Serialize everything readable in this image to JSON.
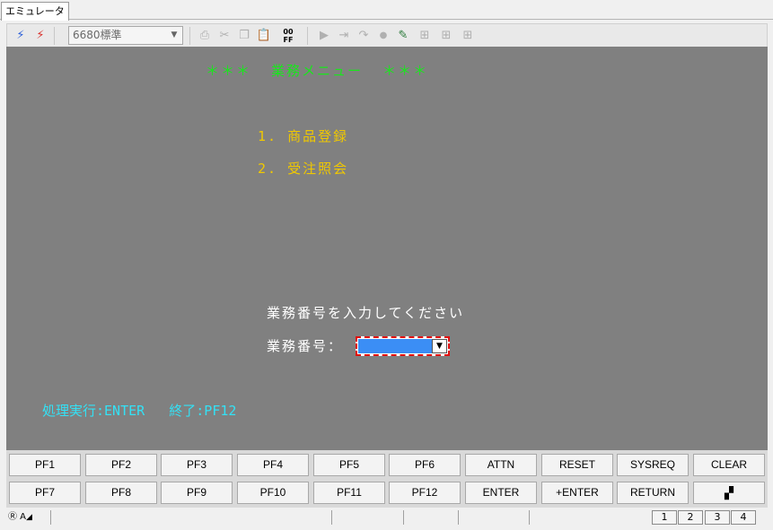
{
  "tab": {
    "label": "エミュレータ"
  },
  "toolbar": {
    "emulation_select": "6680標準",
    "icons": [
      "connect-icon",
      "disconnect-icon",
      "print-icon",
      "cut-icon",
      "copy-icon",
      "paste-icon",
      "onoff-icon",
      "play-icon",
      "step-icon",
      "redo-icon",
      "record-icon",
      "edit-icon",
      "layout1-icon",
      "layout2-icon",
      "layout3-icon"
    ]
  },
  "screen": {
    "title": "＊＊＊  業務メニュー  ＊＊＊",
    "menu": [
      "1. 商品登録",
      "2. 受注照会"
    ],
    "prompt": "業務番号を入力してください",
    "field_label": "業務番号：",
    "field_value": "",
    "footer": "処理実行:ENTER   終了:PF12"
  },
  "keys": {
    "row1": [
      "PF1",
      "PF2",
      "PF3",
      "PF4",
      "PF5",
      "PF6",
      "ATTN",
      "RESET",
      "SYSREQ",
      "CLEAR"
    ],
    "row2": [
      "PF7",
      "PF8",
      "PF9",
      "PF10",
      "PF11",
      "PF12",
      "ENTER",
      "+ENTER",
      "RETURN",
      ""
    ]
  },
  "status": {
    "indicator": "Ⓡ A",
    "pages": [
      "1",
      "2",
      "3",
      "4"
    ]
  },
  "colors": {
    "screen_bg": "#808080",
    "title": "#19e61c",
    "menu": "#f0c800",
    "prompt": "#ffffff",
    "footer": "#33e1f5",
    "input_bg": "#3b8ef5",
    "focus_border": "#e01010"
  }
}
